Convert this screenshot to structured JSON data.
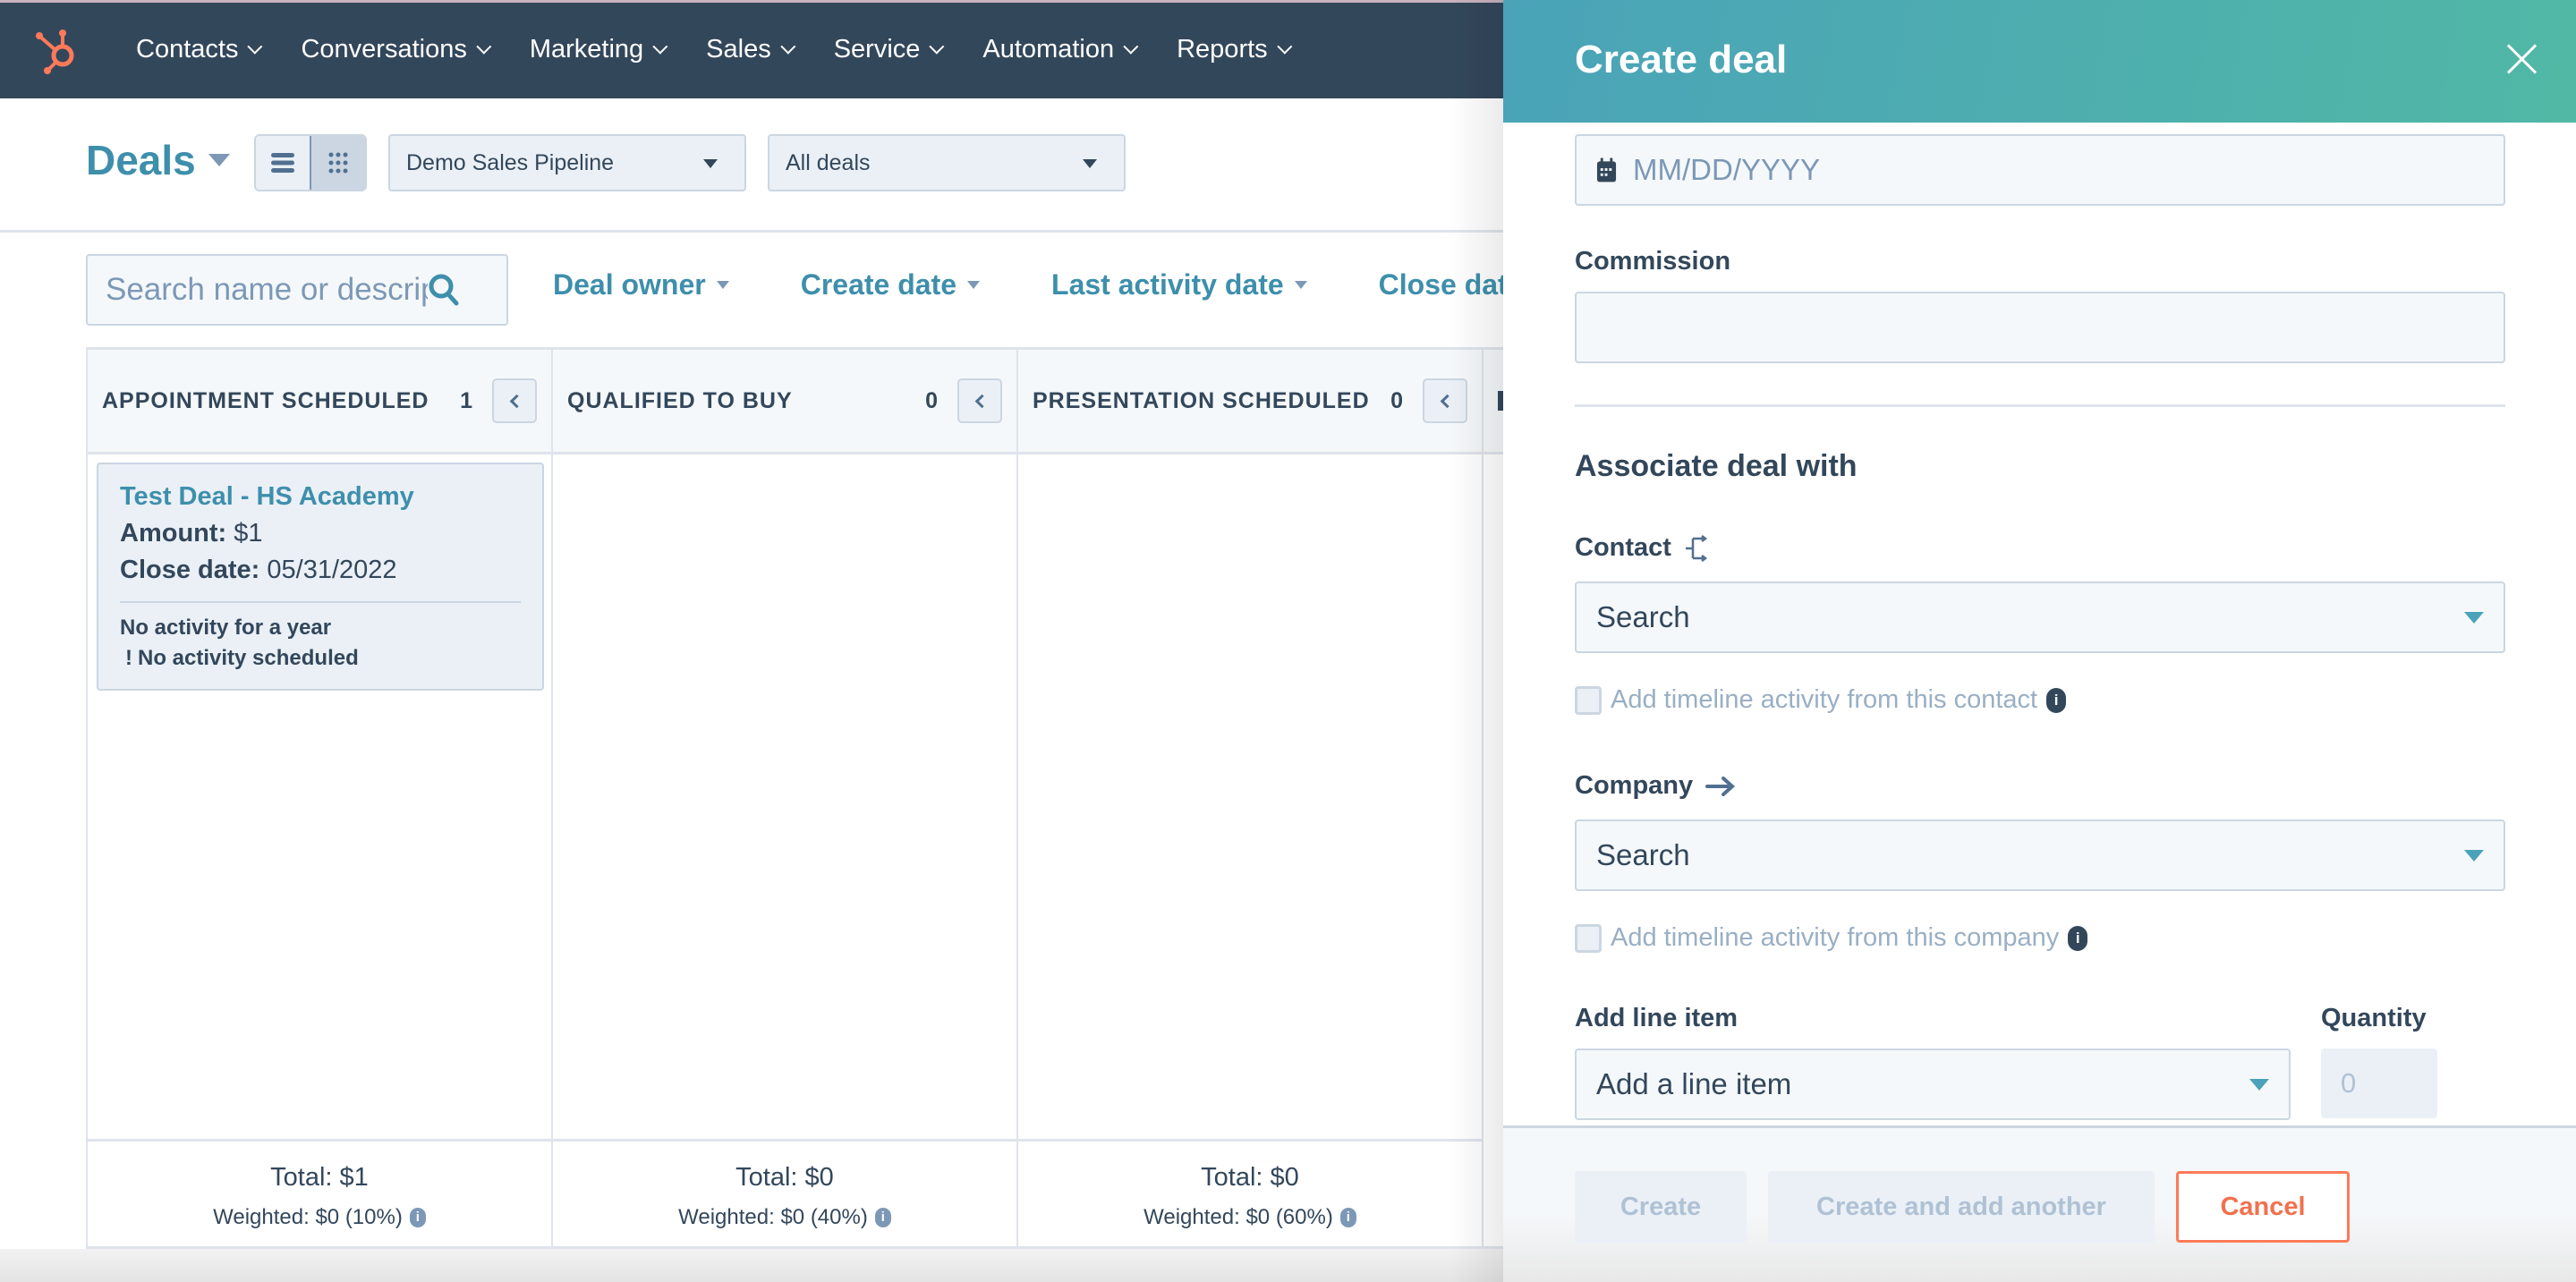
{
  "nav": {
    "logo": "hubspot-sprocket",
    "items": [
      {
        "label": "Contacts"
      },
      {
        "label": "Conversations"
      },
      {
        "label": "Marketing"
      },
      {
        "label": "Sales"
      },
      {
        "label": "Service"
      },
      {
        "label": "Automation"
      },
      {
        "label": "Reports"
      }
    ]
  },
  "header": {
    "title": "Deals",
    "views": [
      {
        "icon": "list-view-icon",
        "active": false
      },
      {
        "icon": "board-view-icon",
        "active": true
      }
    ],
    "pipeline": "Demo Sales Pipeline",
    "view_filter": "All deals"
  },
  "toolbar": {
    "search_placeholder": "Search name or descrip",
    "filters": [
      "Deal owner",
      "Create date",
      "Last activity date",
      "Close date"
    ]
  },
  "board": {
    "columns": [
      {
        "title": "APPOINTMENT SCHEDULED",
        "count": "1",
        "total": "Total: $1",
        "weighted": "Weighted: $0 (10%)"
      },
      {
        "title": "QUALIFIED TO BUY",
        "count": "0",
        "total": "Total: $0",
        "weighted": "Weighted: $0 (40%)"
      },
      {
        "title": "PRESENTATION SCHEDULED",
        "count": "0",
        "total": "Total: $0",
        "weighted": "Weighted: $0 (60%)"
      }
    ],
    "cards": [
      {
        "name": "Test Deal - HS Academy",
        "amount_label": "Amount:",
        "amount": "$1",
        "close_label": "Close date:",
        "close_date": "05/31/2022",
        "activity": "No activity for a year",
        "scheduled": "No activity scheduled"
      }
    ]
  },
  "panel": {
    "title": "Create deal",
    "date_placeholder": "MM/DD/YYYY",
    "commission_label": "Commission",
    "commission_value": "",
    "associate_title": "Associate deal with",
    "contact_label": "Contact",
    "contact_search": "Search",
    "contact_timeline": "Add timeline activity from this contact",
    "company_label": "Company",
    "company_search": "Search",
    "company_timeline": "Add timeline activity from this company",
    "line_item_label": "Add line item",
    "line_item_select": "Add a line item",
    "quantity_label": "Quantity",
    "quantity_placeholder": "0",
    "buttons": {
      "create": "Create",
      "create_another": "Create and add another",
      "cancel": "Cancel"
    }
  },
  "colors": {
    "nav_bg": "#33475b",
    "accent": "#3e8fab",
    "cancel": "#ff7a59",
    "header_gradient_start": "#4aa3b8",
    "header_gradient_end": "#51b8a6"
  }
}
